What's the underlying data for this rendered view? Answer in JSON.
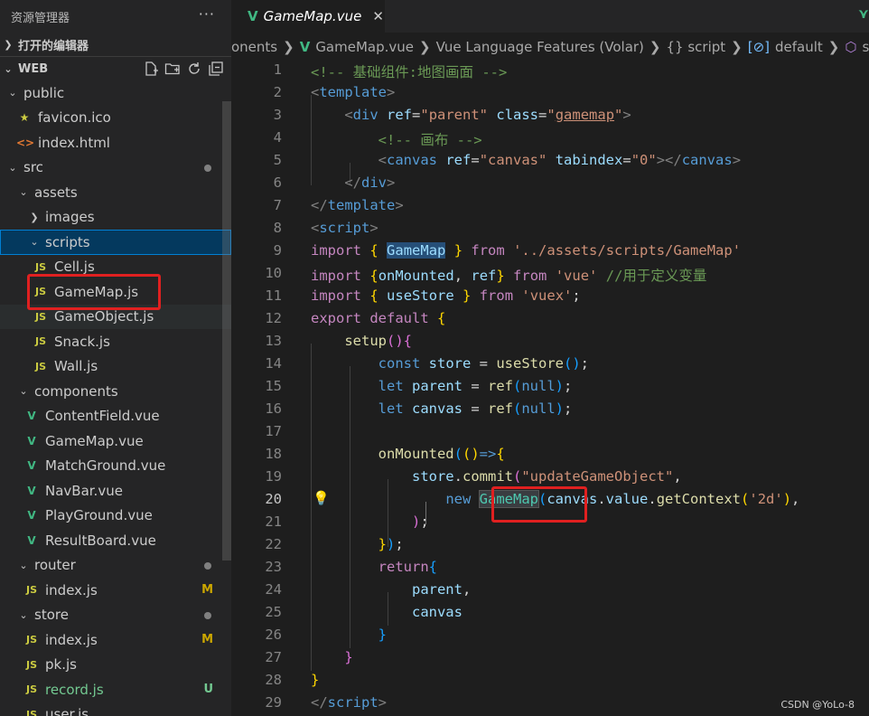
{
  "explorer": {
    "title": "资源管理器",
    "more": "···",
    "open_editors": "打开的编辑器",
    "workspace": "WEB"
  },
  "tree": [
    {
      "label": "public",
      "kind": "folder",
      "depth": 0,
      "open": true
    },
    {
      "label": "favicon.ico",
      "kind": "star",
      "depth": 1
    },
    {
      "label": "index.html",
      "kind": "html",
      "depth": 1
    },
    {
      "label": "src",
      "kind": "folder",
      "depth": 0,
      "open": true,
      "dot": true
    },
    {
      "label": "assets",
      "kind": "folder",
      "depth": 1,
      "open": true
    },
    {
      "label": "images",
      "kind": "folder",
      "depth": 2,
      "open": false
    },
    {
      "label": "scripts",
      "kind": "folder",
      "depth": 2,
      "open": true,
      "selected": true
    },
    {
      "label": "Cell.js",
      "kind": "js",
      "depth": 3
    },
    {
      "label": "GameMap.js",
      "kind": "js",
      "depth": 3
    },
    {
      "label": "GameObject.js",
      "kind": "js",
      "depth": 3,
      "hover": true
    },
    {
      "label": "Snack.js",
      "kind": "js",
      "depth": 3
    },
    {
      "label": "Wall.js",
      "kind": "js",
      "depth": 3
    },
    {
      "label": "components",
      "kind": "folder",
      "depth": 1,
      "open": true
    },
    {
      "label": "ContentField.vue",
      "kind": "vue",
      "depth": 2
    },
    {
      "label": "GameMap.vue",
      "kind": "vue",
      "depth": 2
    },
    {
      "label": "MatchGround.vue",
      "kind": "vue",
      "depth": 2
    },
    {
      "label": "NavBar.vue",
      "kind": "vue",
      "depth": 2
    },
    {
      "label": "PlayGround.vue",
      "kind": "vue",
      "depth": 2
    },
    {
      "label": "ResultBoard.vue",
      "kind": "vue",
      "depth": 2
    },
    {
      "label": "router",
      "kind": "folder",
      "depth": 1,
      "open": true,
      "dot": true
    },
    {
      "label": "index.js",
      "kind": "js",
      "depth": 2,
      "mark": "M"
    },
    {
      "label": "store",
      "kind": "folder",
      "depth": 1,
      "open": true,
      "dot": true
    },
    {
      "label": "index.js",
      "kind": "js",
      "depth": 2,
      "mark": "M"
    },
    {
      "label": "pk.js",
      "kind": "js",
      "depth": 2
    },
    {
      "label": "record.js",
      "kind": "js",
      "depth": 2,
      "mark": "U",
      "untracked": true
    },
    {
      "label": "user.js",
      "kind": "js",
      "depth": 2
    }
  ],
  "tab": {
    "icon": "V",
    "title": "GameMap.vue",
    "close": "✕"
  },
  "breadcrumb": [
    "onents",
    "GameMap.vue",
    "Vue Language Features (Volar)",
    "{} script",
    "default",
    "setup"
  ],
  "code": [
    [
      [
        "cm",
        "<!-- 基础组件:地图画面 -->"
      ]
    ],
    [
      [
        "pn",
        "<"
      ],
      [
        "tg",
        "template"
      ],
      [
        "pn",
        ">"
      ]
    ],
    [
      [
        "tx",
        "    "
      ],
      [
        "pn",
        "<"
      ],
      [
        "tg",
        "div"
      ],
      [
        "tx",
        " "
      ],
      [
        "at",
        "ref"
      ],
      [
        "tx",
        "="
      ],
      [
        "st",
        "\"parent\""
      ],
      [
        "tx",
        " "
      ],
      [
        "at",
        "class"
      ],
      [
        "tx",
        "="
      ],
      [
        "st",
        "\""
      ],
      [
        "st ul",
        "gamemap"
      ],
      [
        "st",
        "\""
      ],
      [
        "pn",
        ">"
      ]
    ],
    [
      [
        "tx",
        "        "
      ],
      [
        "cm",
        "<!-- 画布 -->"
      ]
    ],
    [
      [
        "tx",
        "        "
      ],
      [
        "pn",
        "<"
      ],
      [
        "tg",
        "canvas"
      ],
      [
        "tx",
        " "
      ],
      [
        "at",
        "ref"
      ],
      [
        "tx",
        "="
      ],
      [
        "st",
        "\"canvas\""
      ],
      [
        "tx",
        " "
      ],
      [
        "at",
        "tabindex"
      ],
      [
        "tx",
        "="
      ],
      [
        "st",
        "\"0\""
      ],
      [
        "pn",
        "></"
      ],
      [
        "tg",
        "canvas"
      ],
      [
        "pn",
        ">"
      ]
    ],
    [
      [
        "tx",
        "    "
      ],
      [
        "pn",
        "</"
      ],
      [
        "tg",
        "div"
      ],
      [
        "pn",
        ">"
      ]
    ],
    [
      [
        "pn",
        "</"
      ],
      [
        "tg",
        "template"
      ],
      [
        "pn",
        ">"
      ]
    ],
    [
      [
        "pn",
        "<"
      ],
      [
        "tg",
        "script"
      ],
      [
        "pn",
        ">"
      ]
    ],
    [
      [
        "kw",
        "import"
      ],
      [
        "tx",
        " "
      ],
      [
        "b1",
        "{"
      ],
      [
        "tx",
        " "
      ],
      [
        "vr hl",
        "GameMap"
      ],
      [
        "tx",
        " "
      ],
      [
        "b1",
        "}"
      ],
      [
        "tx",
        " "
      ],
      [
        "kw",
        "from"
      ],
      [
        "tx",
        " "
      ],
      [
        "st",
        "'../assets/scripts/GameMap'"
      ]
    ],
    [
      [
        "kw",
        "import"
      ],
      [
        "tx",
        " "
      ],
      [
        "b1",
        "{"
      ],
      [
        "vr",
        "onMounted"
      ],
      [
        "tx",
        ", "
      ],
      [
        "vr",
        "ref"
      ],
      [
        "b1",
        "}"
      ],
      [
        "tx",
        " "
      ],
      [
        "kw",
        "from"
      ],
      [
        "tx",
        " "
      ],
      [
        "st",
        "'vue'"
      ],
      [
        "tx",
        " "
      ],
      [
        "cm",
        "//用于定义变量"
      ]
    ],
    [
      [
        "kw",
        "import"
      ],
      [
        "tx",
        " "
      ],
      [
        "b1",
        "{"
      ],
      [
        "tx",
        " "
      ],
      [
        "vr",
        "useStore"
      ],
      [
        "tx",
        " "
      ],
      [
        "b1",
        "}"
      ],
      [
        "tx",
        " "
      ],
      [
        "kw",
        "from"
      ],
      [
        "tx",
        " "
      ],
      [
        "st",
        "'vuex'"
      ],
      [
        "tx",
        ";"
      ]
    ],
    [
      [
        "kw",
        "export"
      ],
      [
        "tx",
        " "
      ],
      [
        "kw",
        "default"
      ],
      [
        "tx",
        " "
      ],
      [
        "b1",
        "{"
      ]
    ],
    [
      [
        "tx",
        "    "
      ],
      [
        "fn",
        "setup"
      ],
      [
        "b2",
        "()"
      ],
      [
        "b2",
        "{"
      ]
    ],
    [
      [
        "tx",
        "        "
      ],
      [
        "kb",
        "const"
      ],
      [
        "tx",
        " "
      ],
      [
        "vr",
        "store"
      ],
      [
        "tx",
        " = "
      ],
      [
        "fn",
        "useStore"
      ],
      [
        "b3",
        "()"
      ],
      [
        "tx",
        ";"
      ]
    ],
    [
      [
        "tx",
        "        "
      ],
      [
        "kb",
        "let"
      ],
      [
        "tx",
        " "
      ],
      [
        "vr",
        "parent"
      ],
      [
        "tx",
        " = "
      ],
      [
        "fn",
        "ref"
      ],
      [
        "b3",
        "("
      ],
      [
        "kb",
        "null"
      ],
      [
        "b3",
        ")"
      ],
      [
        "tx",
        ";"
      ]
    ],
    [
      [
        "tx",
        "        "
      ],
      [
        "kb",
        "let"
      ],
      [
        "tx",
        " "
      ],
      [
        "vr",
        "canvas"
      ],
      [
        "tx",
        " = "
      ],
      [
        "fn",
        "ref"
      ],
      [
        "b3",
        "("
      ],
      [
        "kb",
        "null"
      ],
      [
        "b3",
        ")"
      ],
      [
        "tx",
        ";"
      ]
    ],
    [],
    [
      [
        "tx",
        "        "
      ],
      [
        "fn",
        "onMounted"
      ],
      [
        "b3",
        "("
      ],
      [
        "b1",
        "()"
      ],
      [
        "kb",
        "=>"
      ],
      [
        "b1",
        "{"
      ]
    ],
    [
      [
        "tx",
        "            "
      ],
      [
        "vr",
        "store"
      ],
      [
        "tx",
        "."
      ],
      [
        "fn",
        "commit"
      ],
      [
        "b2",
        "("
      ],
      [
        "st",
        "\"updateGameObject\""
      ],
      [
        "tx",
        ","
      ]
    ],
    [
      [
        "tx",
        "                "
      ],
      [
        "kb",
        "new"
      ],
      [
        "tx",
        " "
      ],
      [
        "cls hl2",
        "GameMap"
      ],
      [
        "b3",
        "("
      ],
      [
        "vr",
        "canvas"
      ],
      [
        "tx",
        "."
      ],
      [
        "vr",
        "value"
      ],
      [
        "tx",
        "."
      ],
      [
        "fn",
        "getContext"
      ],
      [
        "b1",
        "("
      ],
      [
        "st",
        "'2d'"
      ],
      [
        "b1",
        ")"
      ],
      [
        "tx",
        ","
      ]
    ],
    [
      [
        "tx",
        "            "
      ],
      [
        "b2",
        ")"
      ],
      [
        "tx",
        ";"
      ]
    ],
    [
      [
        "tx",
        "        "
      ],
      [
        "b1",
        "}"
      ],
      [
        "b3",
        ")"
      ],
      [
        "tx",
        ";"
      ]
    ],
    [
      [
        "tx",
        "        "
      ],
      [
        "kw",
        "return"
      ],
      [
        "b3",
        "{"
      ]
    ],
    [
      [
        "tx",
        "            "
      ],
      [
        "vr",
        "parent"
      ],
      [
        "tx",
        ","
      ]
    ],
    [
      [
        "tx",
        "            "
      ],
      [
        "vr",
        "canvas"
      ]
    ],
    [
      [
        "tx",
        "        "
      ],
      [
        "b3",
        "}"
      ]
    ],
    [
      [
        "tx",
        "    "
      ],
      [
        "b2",
        "}"
      ]
    ],
    [
      [
        "b1",
        "}"
      ]
    ],
    [
      [
        "pn",
        "</"
      ],
      [
        "tg",
        "script"
      ],
      [
        "pn",
        ">"
      ]
    ]
  ],
  "active_line": 20,
  "watermark": "CSDN @YoLo-8"
}
